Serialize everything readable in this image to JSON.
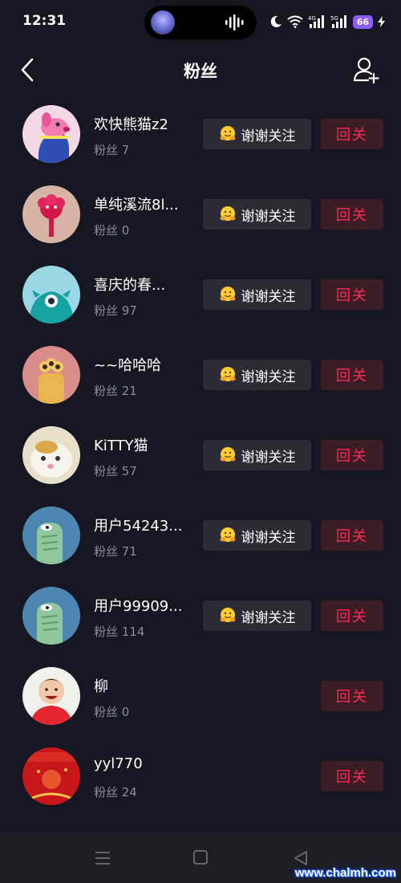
{
  "status_bar": {
    "time": "12:31",
    "battery": "66",
    "net1": "4G",
    "net2": "5G"
  },
  "header": {
    "title": "粉丝",
    "back_icon": "chevron-left-icon",
    "add_icon": "add-user-icon"
  },
  "labels": {
    "thanks": "谢谢关注",
    "follow_back": "回关"
  },
  "fans": [
    {
      "name": "欢快熊猫z2",
      "count": "粉丝 7",
      "thanks": true,
      "avatar": "pink-dog"
    },
    {
      "name": "单纯溪流8l...",
      "count": "粉丝 0",
      "thanks": true,
      "avatar": "red-flower"
    },
    {
      "name": "喜庆的春...",
      "count": "粉丝 97",
      "thanks": true,
      "avatar": "teal-monster"
    },
    {
      "name": "~~哈哈哈",
      "count": "粉丝 21",
      "thanks": true,
      "avatar": "yellow-creature"
    },
    {
      "name": "KiTTY猫",
      "count": "粉丝 57",
      "thanks": true,
      "avatar": "cat-photo"
    },
    {
      "name": "用户54243...",
      "count": "粉丝 71",
      "thanks": true,
      "avatar": "green-dino"
    },
    {
      "name": "用户99909...",
      "count": "粉丝 114",
      "thanks": true,
      "avatar": "green-dino"
    },
    {
      "name": "柳",
      "count": "粉丝 0",
      "thanks": false,
      "avatar": "child-photo"
    },
    {
      "name": "yyl770",
      "count": "粉丝 24",
      "thanks": false,
      "avatar": "red-festive"
    }
  ],
  "nav_bar": {
    "menu_icon": "menu-icon",
    "home_icon": "home-square-icon",
    "back_icon": "back-triangle-icon"
  },
  "watermark": "www.chalmh.com"
}
